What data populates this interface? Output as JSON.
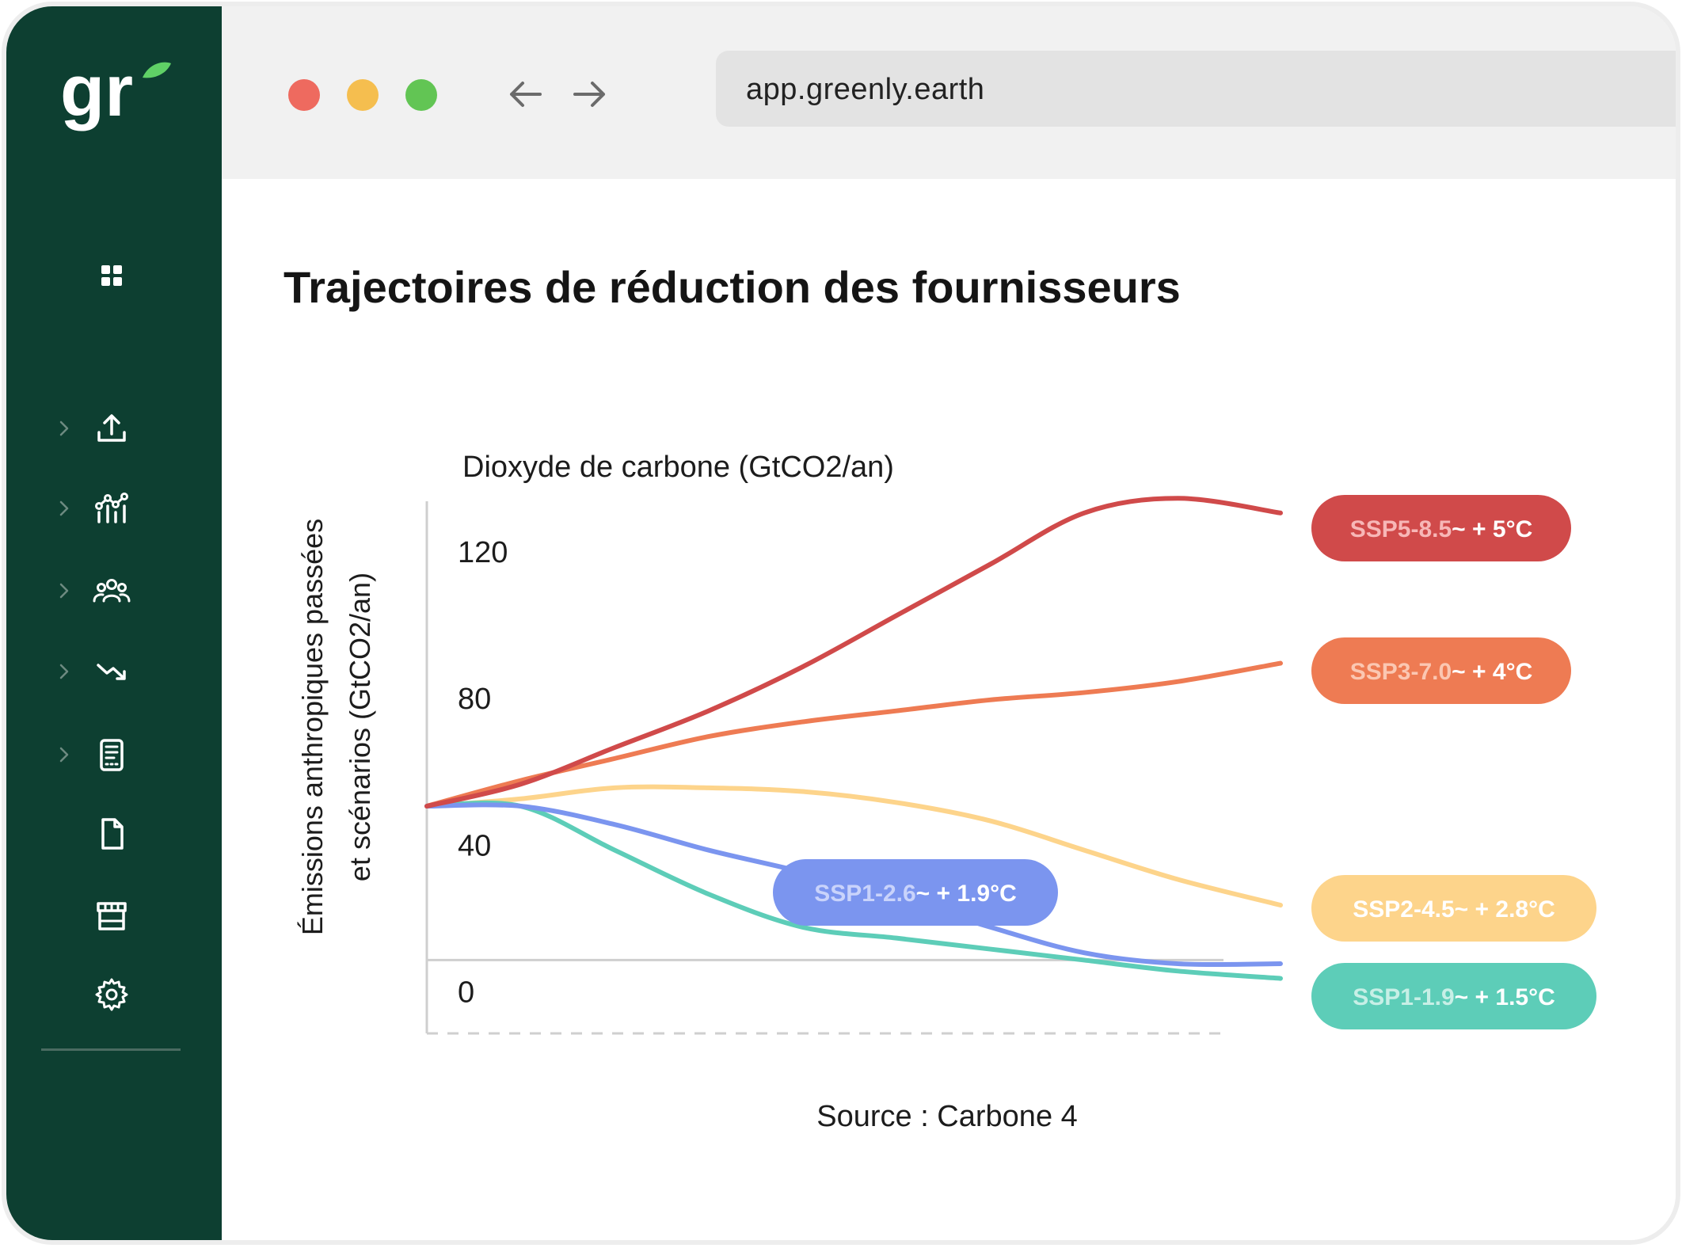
{
  "browser": {
    "url": "app.greenly.earth",
    "traffic_lights": [
      "#ee6a5f",
      "#f5be4f",
      "#62c554"
    ]
  },
  "sidebar": {
    "logo_text": "gr",
    "items": [
      {
        "icon": "grid-icon",
        "has_chevron": false
      },
      {
        "icon": "upload-icon",
        "has_chevron": true
      },
      {
        "icon": "analytics-icon",
        "has_chevron": true
      },
      {
        "icon": "users-icon",
        "has_chevron": true
      },
      {
        "icon": "trend-down-icon",
        "has_chevron": true
      },
      {
        "icon": "calculator-icon",
        "has_chevron": true
      },
      {
        "icon": "document-icon",
        "has_chevron": false
      },
      {
        "icon": "store-icon",
        "has_chevron": false
      },
      {
        "icon": "gear-icon",
        "has_chevron": false
      }
    ]
  },
  "colors": {
    "sidebar_bg": "#0d3f31",
    "ssp585": "#d04a4a",
    "ssp370": "#ee7b53",
    "ssp245": "#fdd48b",
    "ssp126": "#7b95ef",
    "ssp119": "#5dcdb8"
  },
  "page": {
    "title": "Trajectoires de réduction des fournisseurs"
  },
  "chart_data": {
    "type": "line",
    "title": "Dioxyde de carbone (GtCO2/an)",
    "ylabel_line1": "Émissions anthropiques passées",
    "ylabel_line2": "et scénarios (GtCO2/an)",
    "source": "Source : Carbone 4",
    "yticks": [
      0,
      40,
      80,
      120
    ],
    "ylim": [
      -20,
      128
    ],
    "xlim": [
      0,
      100
    ],
    "x_axis_labels": false,
    "grid": false,
    "legend": "right",
    "series": [
      {
        "name": "SSP5-8.5",
        "temp": "~ + 5°C",
        "color": "#d04a4a",
        "x": [
          0,
          11,
          22,
          33,
          44,
          55,
          66,
          77,
          88,
          100
        ],
        "y": [
          42,
          48,
          58,
          68,
          80,
          94,
          108,
          122,
          126,
          122
        ]
      },
      {
        "name": "SSP3-7.0",
        "temp": "~ + 4°C",
        "color": "#ee7b53",
        "x": [
          0,
          11,
          22,
          33,
          44,
          55,
          66,
          77,
          88,
          100
        ],
        "y": [
          42,
          49,
          55,
          61,
          65,
          68,
          71,
          73,
          76,
          81
        ]
      },
      {
        "name": "SSP2-4.5",
        "temp": "~ + 2.8°C",
        "color": "#fdd48b",
        "x": [
          0,
          11,
          22,
          33,
          44,
          55,
          66,
          77,
          88,
          100
        ],
        "y": [
          42,
          44,
          47,
          47,
          46,
          43,
          38,
          30,
          22,
          15
        ]
      },
      {
        "name": "SSP1-2.6",
        "temp": "~ + 1.9°C",
        "color": "#7b95ef",
        "x": [
          0,
          11,
          22,
          33,
          44,
          55,
          66,
          77,
          88,
          100
        ],
        "y": [
          42,
          42,
          37,
          30,
          24,
          17,
          9,
          2,
          -1,
          -1
        ]
      },
      {
        "name": "SSP1-1.9",
        "temp": "~ + 1.5°C",
        "color": "#5dcdb8",
        "x": [
          0,
          11,
          22,
          33,
          44,
          55,
          66,
          77,
          88,
          100
        ],
        "y": [
          42,
          42,
          30,
          18,
          9,
          6,
          3,
          0,
          -3,
          -5
        ]
      }
    ]
  }
}
